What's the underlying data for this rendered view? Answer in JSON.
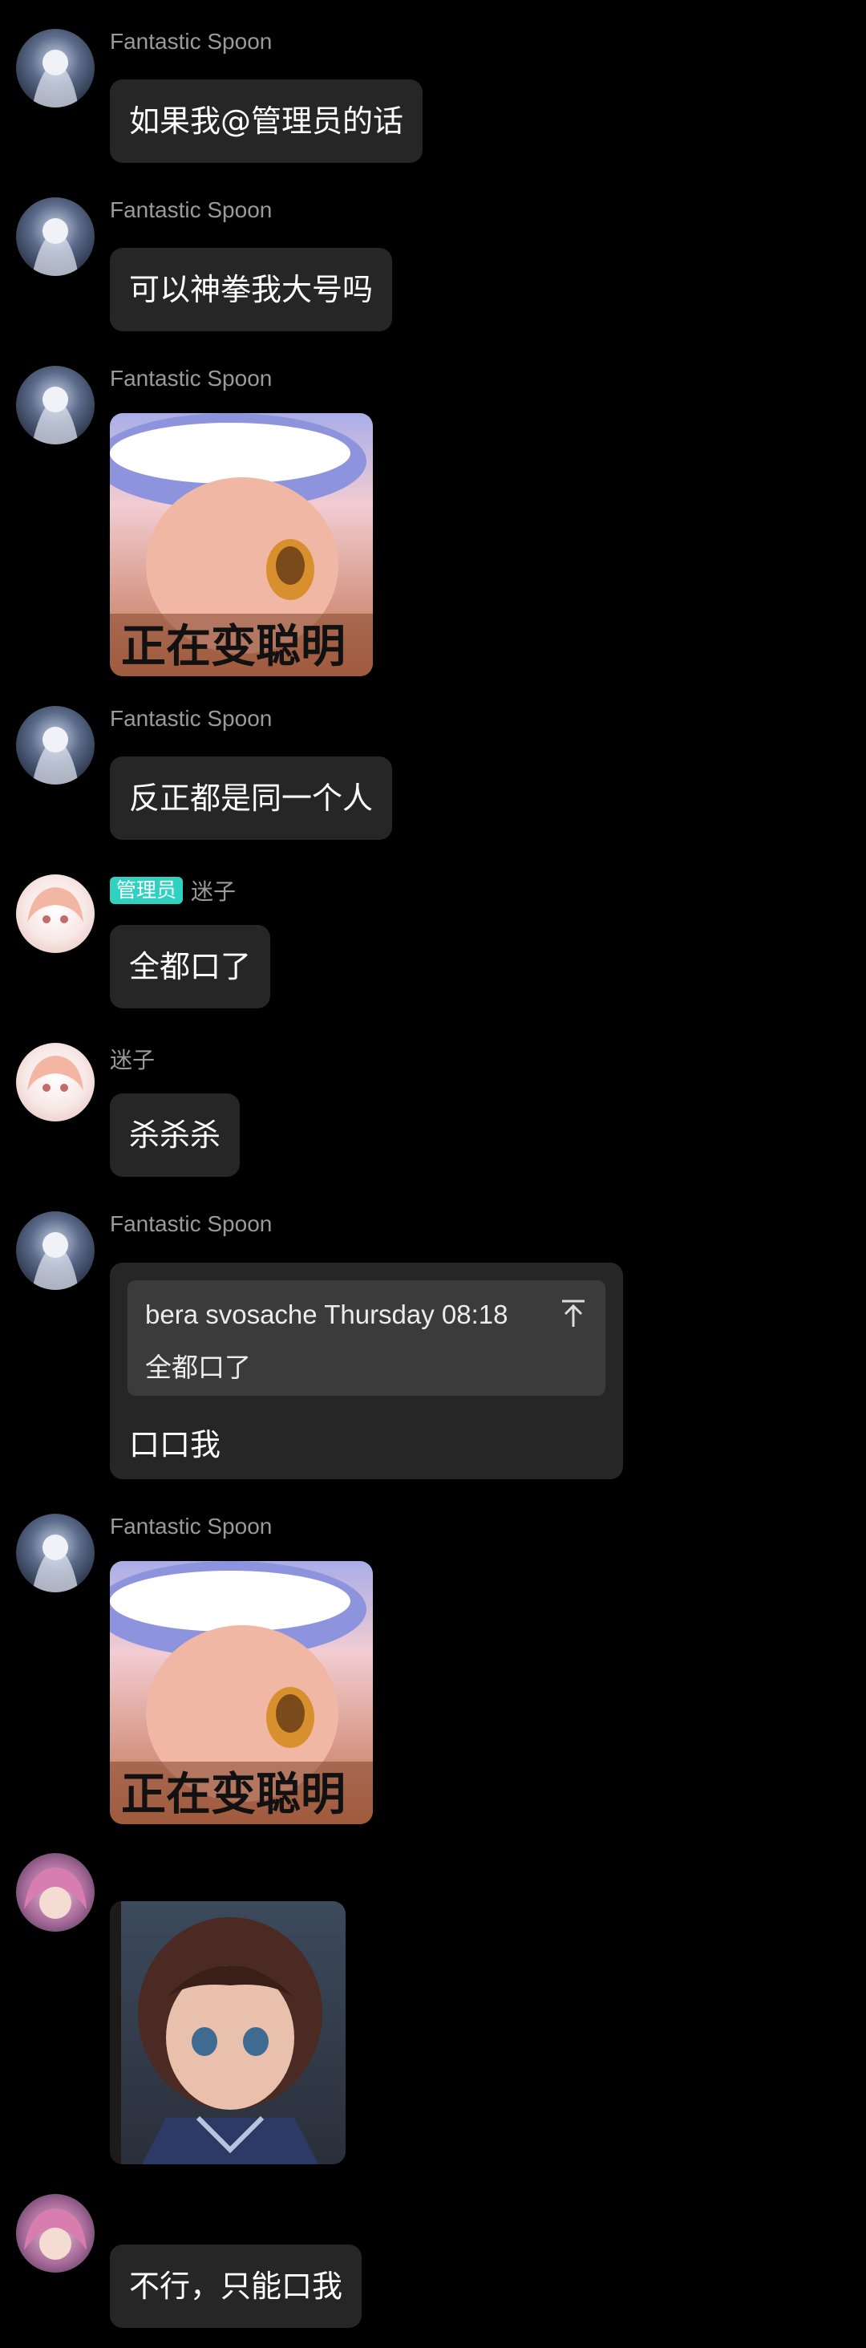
{
  "messages": [
    {
      "sender": "Fantastic Spoon",
      "text": "如果我@管理员的话"
    },
    {
      "sender": "Fantastic Spoon",
      "text": "可以神拳我大号吗"
    },
    {
      "sender": "Fantastic Spoon",
      "sticker_caption": "正在变聪明"
    },
    {
      "sender": "Fantastic Spoon",
      "text": "反正都是同一个人"
    },
    {
      "sender": "迷子",
      "badge": "管理员",
      "text": "全都口了"
    },
    {
      "sender": "迷子",
      "text": "杀杀杀"
    },
    {
      "sender": "Fantastic Spoon",
      "reply": {
        "quoted_header": "bera svosache Thursday 08:18",
        "quoted_text": "全都口了",
        "jump_icon": "jump-to-top-icon"
      },
      "text": "口口我"
    },
    {
      "sender": "Fantastic Spoon",
      "sticker_caption": "正在变聪明"
    },
    {
      "sender": "",
      "image": "anime-girl-photo"
    },
    {
      "sender": "",
      "text": "不行，只能口我"
    }
  ],
  "colors": {
    "background": "#000000",
    "bubble": "#262626",
    "quote_box": "#3b3b3b",
    "sender_name": "#9a9a9a",
    "admin_badge": "#2fd1c1"
  }
}
